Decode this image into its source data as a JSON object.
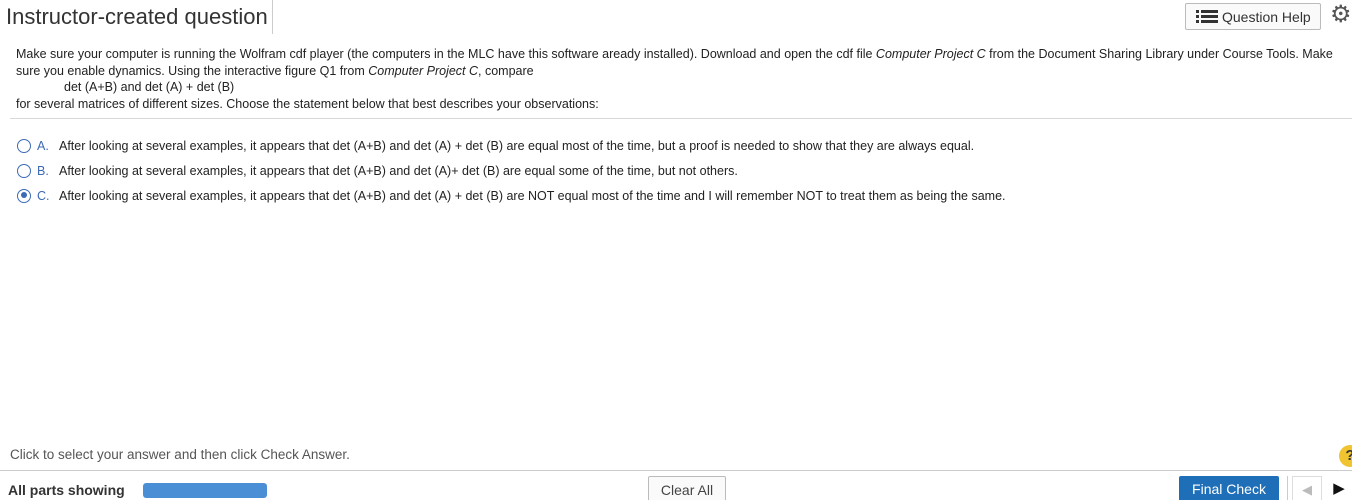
{
  "header": {
    "title": "Instructor-created question",
    "help_label": "Question Help",
    "help_icon": "list-icon",
    "settings_icon": "gear-icon"
  },
  "instructions": {
    "line1_a": "Make sure your computer is running the Wolfram cdf player (the computers in the MLC have this software aready installed).  Download and open the cdf file ",
    "line1_em": "Computer Project C",
    "line1_b": " from the Document Sharing Library under Course Tools.  Make sure you enable dynamics.  Using the interactive figure Q1 from ",
    "line1_em2": "Computer Project C",
    "line1_c": ", compare",
    "formula": "det (A+B) and det (A) + det (B)",
    "line3": "for several matrices of different sizes.   Choose the statement below that best describes your observations:"
  },
  "options": [
    {
      "letter": "A.",
      "text": "After looking at several examples, it appears that det (A+B) and det (A) + det (B) are equal most of the time, but a proof is needed to show that they are always equal.",
      "selected": false
    },
    {
      "letter": "B.",
      "text": "After looking at several examples, it appears that det (A+B) and det (A)+ det (B) are equal some of the time, but not others.",
      "selected": false
    },
    {
      "letter": "C.",
      "text": "After looking at several examples, it appears that det (A+B) and det (A) + det (B) are NOT equal most of the time and I will remember NOT to treat them as being the same.",
      "selected": true
    }
  ],
  "footer": {
    "hint_text": "Click to select your answer and then click Check Answer.",
    "hint_icon": "?",
    "parts_label": "All parts showing",
    "progress_fraction": 1.0,
    "clear_label": "Clear All",
    "final_label": "Final Check",
    "prev_icon": "◀",
    "next_icon": "▶"
  },
  "colors": {
    "accent": "#3d6ab5",
    "final_button": "#1f6fb8",
    "progress": "#4a8fd6"
  }
}
